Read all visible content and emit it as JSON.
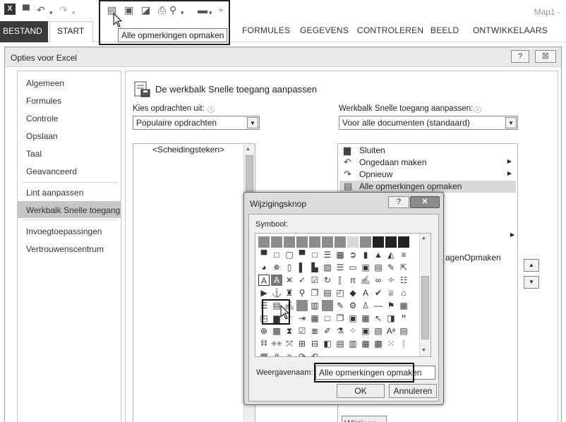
{
  "app": {
    "title": "Map1 -"
  },
  "qat": {
    "tooltip": "Alle opmerkingen opmaken",
    "icons": [
      "excel-logo-icon",
      "save-icon",
      "undo-icon",
      "redo-icon",
      "comment-format-icon",
      "image-icon",
      "folder-icon",
      "print-icon",
      "pointer-icon",
      "save-dropdown-icon",
      "customize-qat-icon"
    ]
  },
  "tabs": [
    "BESTAND",
    "START",
    "FORMULES",
    "GEGEVENS",
    "CONTROLEREN",
    "BEELD",
    "ONTWIKKELAARS"
  ],
  "options_dialog": {
    "title": "Opties voor Excel",
    "help": "?",
    "close": "☒",
    "nav": [
      "Algemeen",
      "Formules",
      "Controle",
      "Opslaan",
      "Taal",
      "Geavanceerd",
      "Lint aanpassen",
      "Werkbalk Snelle toegang",
      "Invoegtoepassingen",
      "Vertrouwenscentrum"
    ],
    "nav_selected": "Werkbalk Snelle toegang",
    "section_title": "De werkbalk Snelle toegang aanpassen",
    "choose_label": "Kies opdrachten uit:",
    "choose_value": "Populaire opdrachten",
    "customize_label": "Werkbalk Snelle toegang aanpassen:",
    "customize_value": "Voor alle documenten (standaard)",
    "left_list": [
      "<Scheidingsteken>"
    ],
    "right_list": [
      {
        "label": "Sluiten",
        "icon": "close-file-icon"
      },
      {
        "label": "Ongedaan maken",
        "icon": "undo-icon",
        "has_sub": true
      },
      {
        "label": "Opnieuw",
        "icon": "redo-icon",
        "has_sub": true
      },
      {
        "label": "Alle opmerkingen opmaken",
        "icon": "comment-format-icon",
        "selected": true
      }
    ],
    "right_list_partial": "agenOpmaken",
    "modify_button": "Wijzigen..."
  },
  "modify_dialog": {
    "title": "Wijzigingsknop",
    "help": "?",
    "close": "✕",
    "symbol_label": "Symbool:",
    "display_name_label": "Weergavenaam:",
    "display_name_value": "Alle opmerkingen opmaken",
    "ok": "OK",
    "cancel": "Annuleren"
  }
}
